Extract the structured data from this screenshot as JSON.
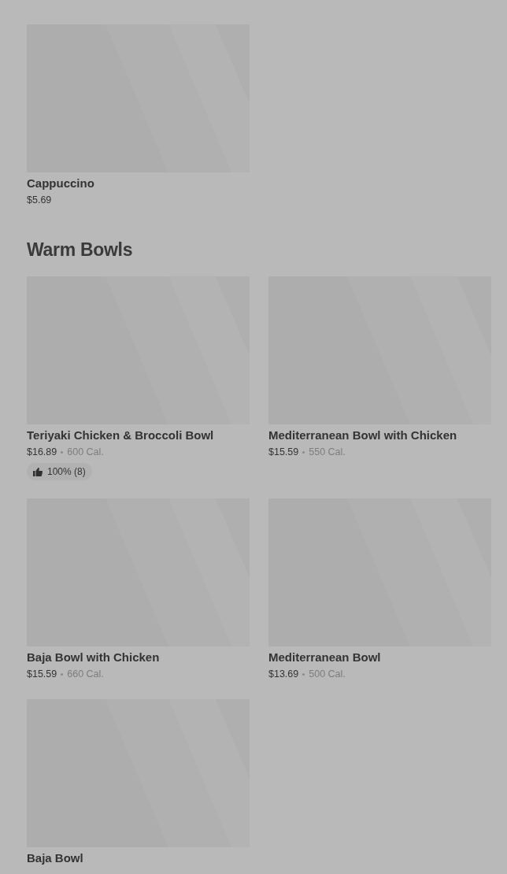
{
  "sections": [
    {
      "items": [
        {
          "name": "Cappuccino",
          "price": "$5.69"
        }
      ]
    },
    {
      "title": "Warm Bowls",
      "items": [
        {
          "name": "Teriyaki Chicken & Broccoli Bowl",
          "price": "$16.89",
          "calories": "600 Cal.",
          "rating": "100% (8)"
        },
        {
          "name": "Mediterranean Bowl with Chicken",
          "price": "$15.59",
          "calories": "550 Cal."
        },
        {
          "name": "Baja Bowl with Chicken",
          "price": "$15.59",
          "calories": "660 Cal."
        },
        {
          "name": "Mediterranean Bowl",
          "price": "$13.69",
          "calories": "500 Cal."
        },
        {
          "name": "Baja Bowl"
        }
      ]
    }
  ]
}
